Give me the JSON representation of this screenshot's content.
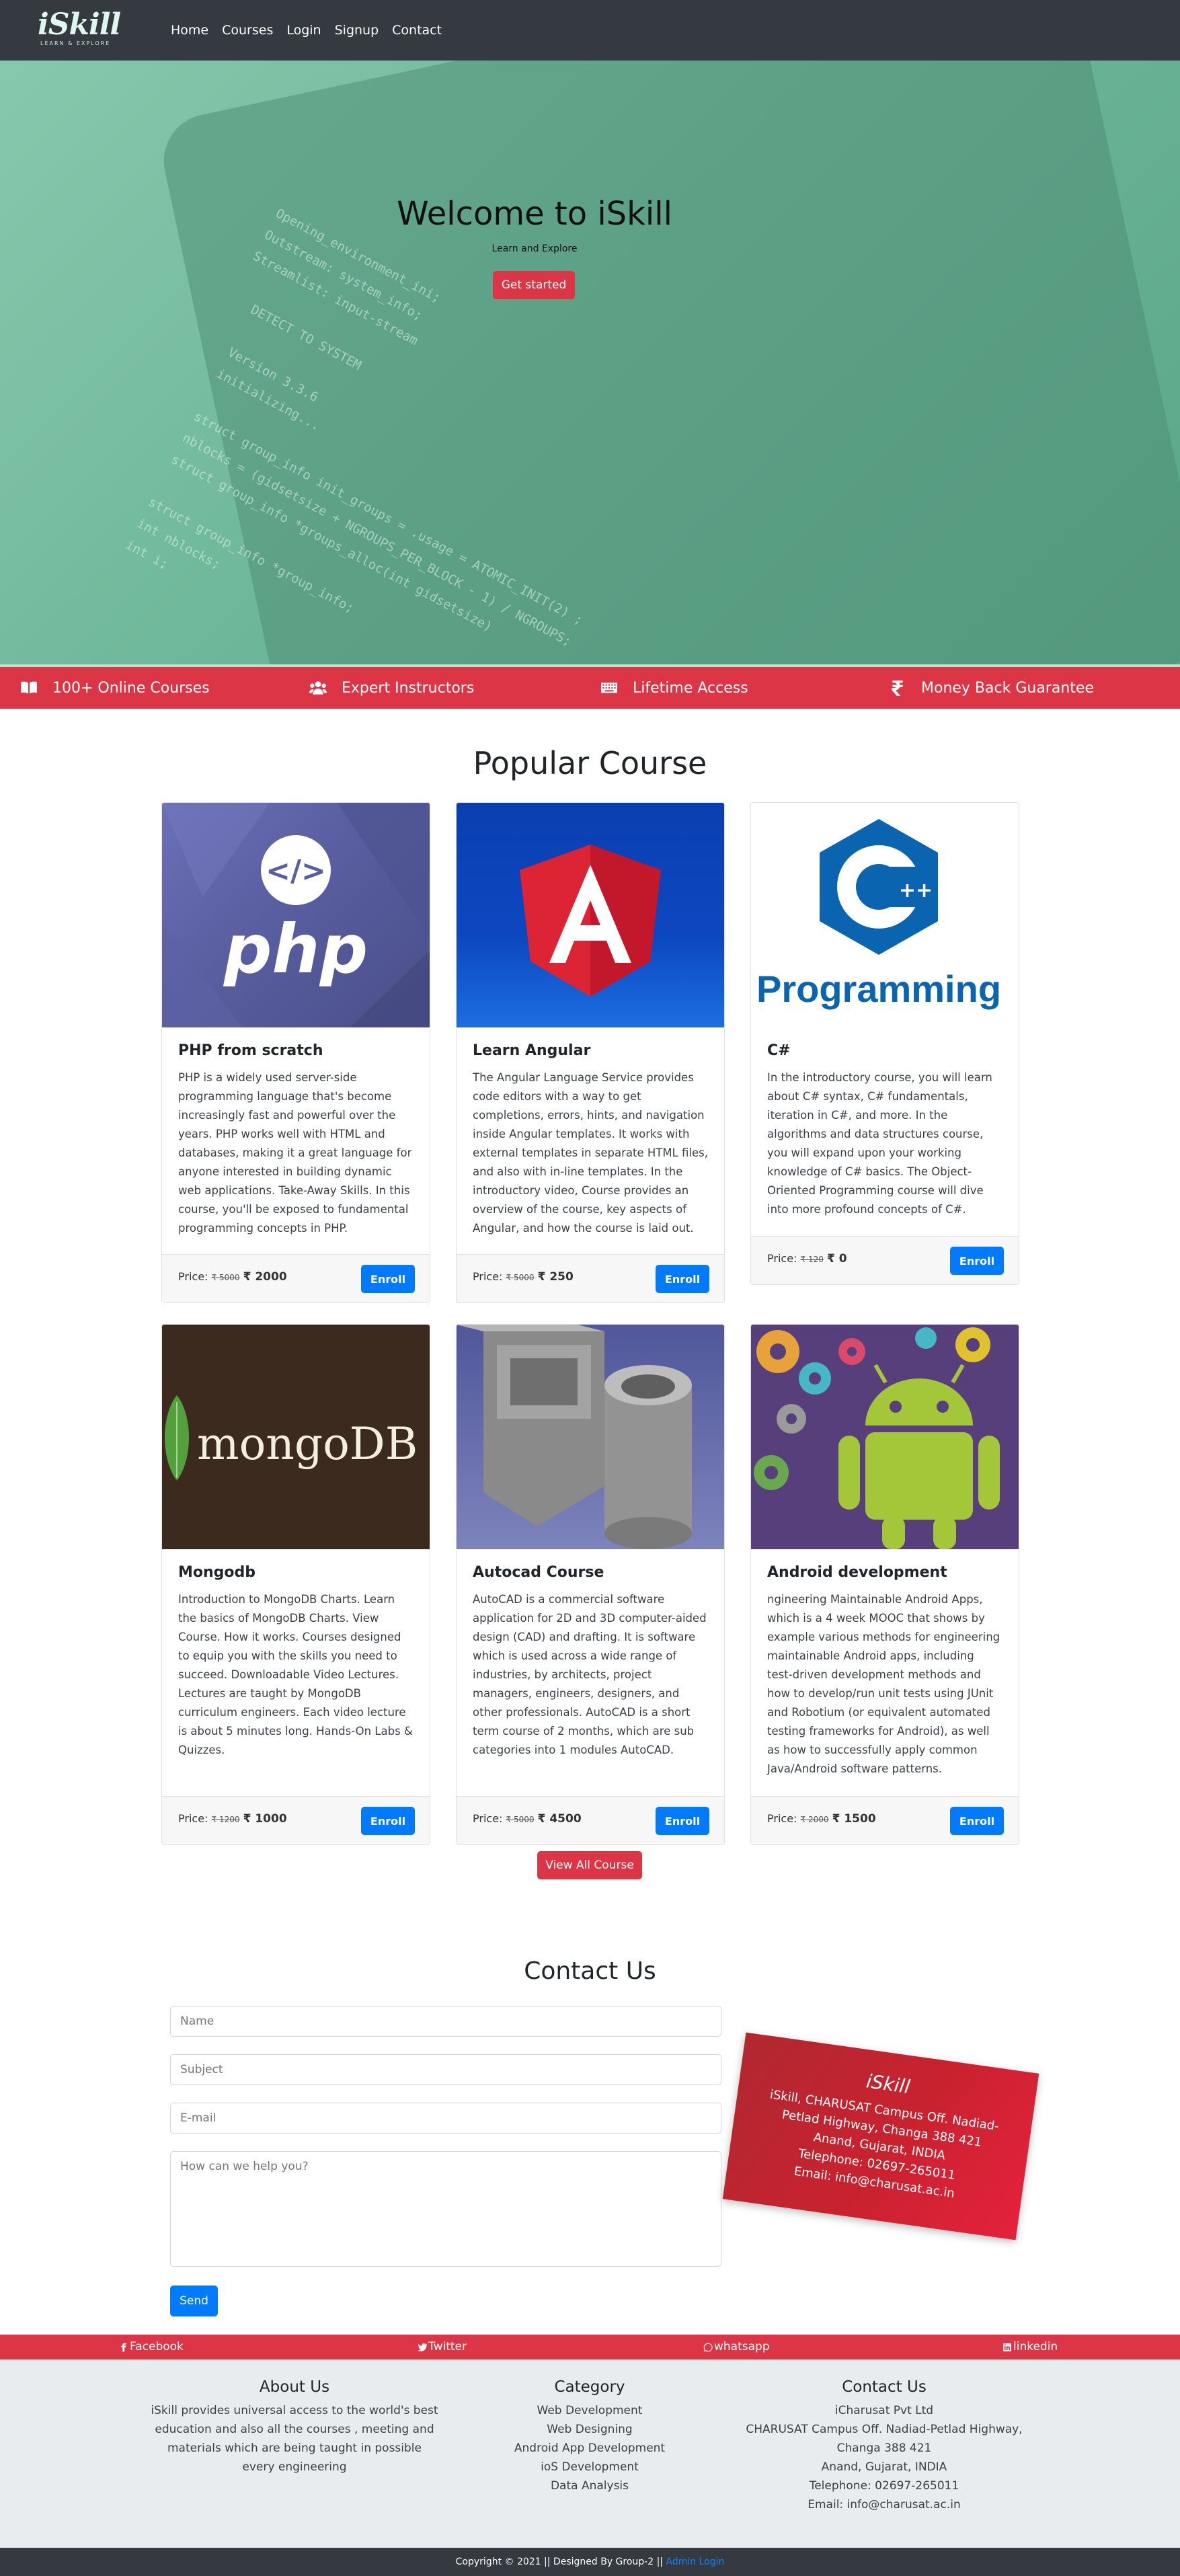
{
  "brand": {
    "logo": "iSkill",
    "logo_tagline": "LEARN & EXPLORE",
    "color_primary": "#dc3545",
    "color_accent": "#007bff"
  },
  "nav": {
    "items": [
      "Home",
      "Courses",
      "Login",
      "Signup",
      "Contact"
    ]
  },
  "hero": {
    "title": "Welcome to iSkill",
    "subtitle": "Learn and Explore",
    "button": "Get started"
  },
  "features": [
    {
      "label": "100+ Online Courses",
      "icon": "book-icon"
    },
    {
      "label": "Expert Instructors",
      "icon": "users-icon"
    },
    {
      "label": "Lifetime Access",
      "icon": "keyboard-icon"
    },
    {
      "label": "Money Back Guarantee",
      "icon": "rupee-icon"
    }
  ],
  "popular": {
    "title": "Popular Course",
    "view_all": "View All Course",
    "price_label": "Price:",
    "enroll": "Enroll",
    "courses": [
      {
        "title": "PHP from scratch",
        "image": "php-logo",
        "text": "PHP is a widely used server-side programming language that's become increasingly fast and powerful over the years. PHP works well with HTML and databases, making it a great language for anyone interested in building dynamic web applications. Take-Away Skills. In this course, you'll be exposed to fundamental programming concepts in PHP.",
        "old_price": "₹ 5000",
        "new_price": "₹ 2000"
      },
      {
        "title": "Learn Angular",
        "image": "angular-logo",
        "text": "The Angular Language Service provides code editors with a way to get completions, errors, hints, and navigation inside Angular templates. It works with external templates in separate HTML files, and also with in-line templates. In the introductory video, Course provides an overview of the course, key aspects of Angular, and how the course is laid out.",
        "old_price": "₹ 5000",
        "new_price": "₹ 250"
      },
      {
        "title": "C#",
        "image": "csharp-programming-logo",
        "image_text": "Programming",
        "text": "In the introductory course, you will learn about C# syntax, C# fundamentals, iteration in C#, and more. In the algorithms and data structures course, you will expand upon your working knowledge of C# basics. The Object-Oriented Programming course will dive into more profound concepts of C#.",
        "old_price": "₹ 120",
        "new_price": "₹ 0"
      },
      {
        "title": "Mongodb",
        "image": "mongodb-logo",
        "image_text": "mongoDB",
        "text": "Introduction to MongoDB Charts. Learn the basics of MongoDB Charts. View Course. How it works. Courses designed to equip you with the skills you need to succeed. Downloadable Video Lectures. Lectures are taught by MongoDB curriculum engineers. Each video lecture is about 5 minutes long. Hands-On Labs & Quizzes.",
        "old_price": "₹ 1200",
        "new_price": "₹ 1000"
      },
      {
        "title": "Autocad Course",
        "image": "autocad-3d-part",
        "text": "AutoCAD is a commercial software application for 2D and 3D computer-aided design (CAD) and drafting. It is software which is used across a wide range of industries, by architects, project managers, engineers, designers, and other professionals. AutoCAD is a short term course of 2 months, which are sub categories into 1 modules AutoCAD.",
        "old_price": "₹ 5000",
        "new_price": "₹ 4500"
      },
      {
        "title": "Android development",
        "image": "android-robot-gears",
        "text": "ngineering Maintainable Android Apps, which is a 4 week MOOC that shows by example various methods for engineering maintainable Android apps, including test-driven development methods and how to develop/run unit tests using JUnit and Robotium (or equivalent automated testing frameworks for Android), as well as how to successfully apply common Java/Android software patterns.",
        "old_price": "₹ 2000",
        "new_price": "₹ 1500"
      }
    ]
  },
  "contact": {
    "title": "Contact Us",
    "name_placeholder": "Name",
    "subject_placeholder": "Subject",
    "email_placeholder": "E-mail",
    "message_placeholder": "How can we help you?",
    "send": "Send",
    "card": {
      "title": "iSkill",
      "lines": [
        "iSkill, CHARUSAT Campus Off. Nadiad-",
        "Petlad Highway, Changa 388 421",
        "Anand, Gujarat, INDIA",
        "Telephone: 02697-265011",
        "Email: info@charusat.ac.in"
      ]
    }
  },
  "social": [
    "Facebook",
    "Twitter",
    "whatsapp",
    "linkedin"
  ],
  "footer": {
    "about": {
      "title": "About Us",
      "text": [
        "iSkill provides universal access to the world's best",
        "education and also all the courses , meeting and",
        "materials which are being taught in possible",
        "every engineering"
      ]
    },
    "category": {
      "title": "Category",
      "items": [
        "Web Development",
        "Web Designing",
        "Android App Development",
        "ioS Development",
        "Data Analysis"
      ]
    },
    "contact": {
      "title": "Contact Us",
      "lines": [
        "iCharusat Pvt Ltd",
        "CHARUSAT Campus Off. Nadiad-Petlad Highway,",
        "Changa 388 421",
        "Anand, Gujarat, INDIA",
        "Telephone: 02697-265011",
        "Email: info@charusat.ac.in"
      ]
    },
    "copyright": "Copyright © 2021 || Designed By Group-2 ||",
    "admin_link": "Admin Login"
  }
}
